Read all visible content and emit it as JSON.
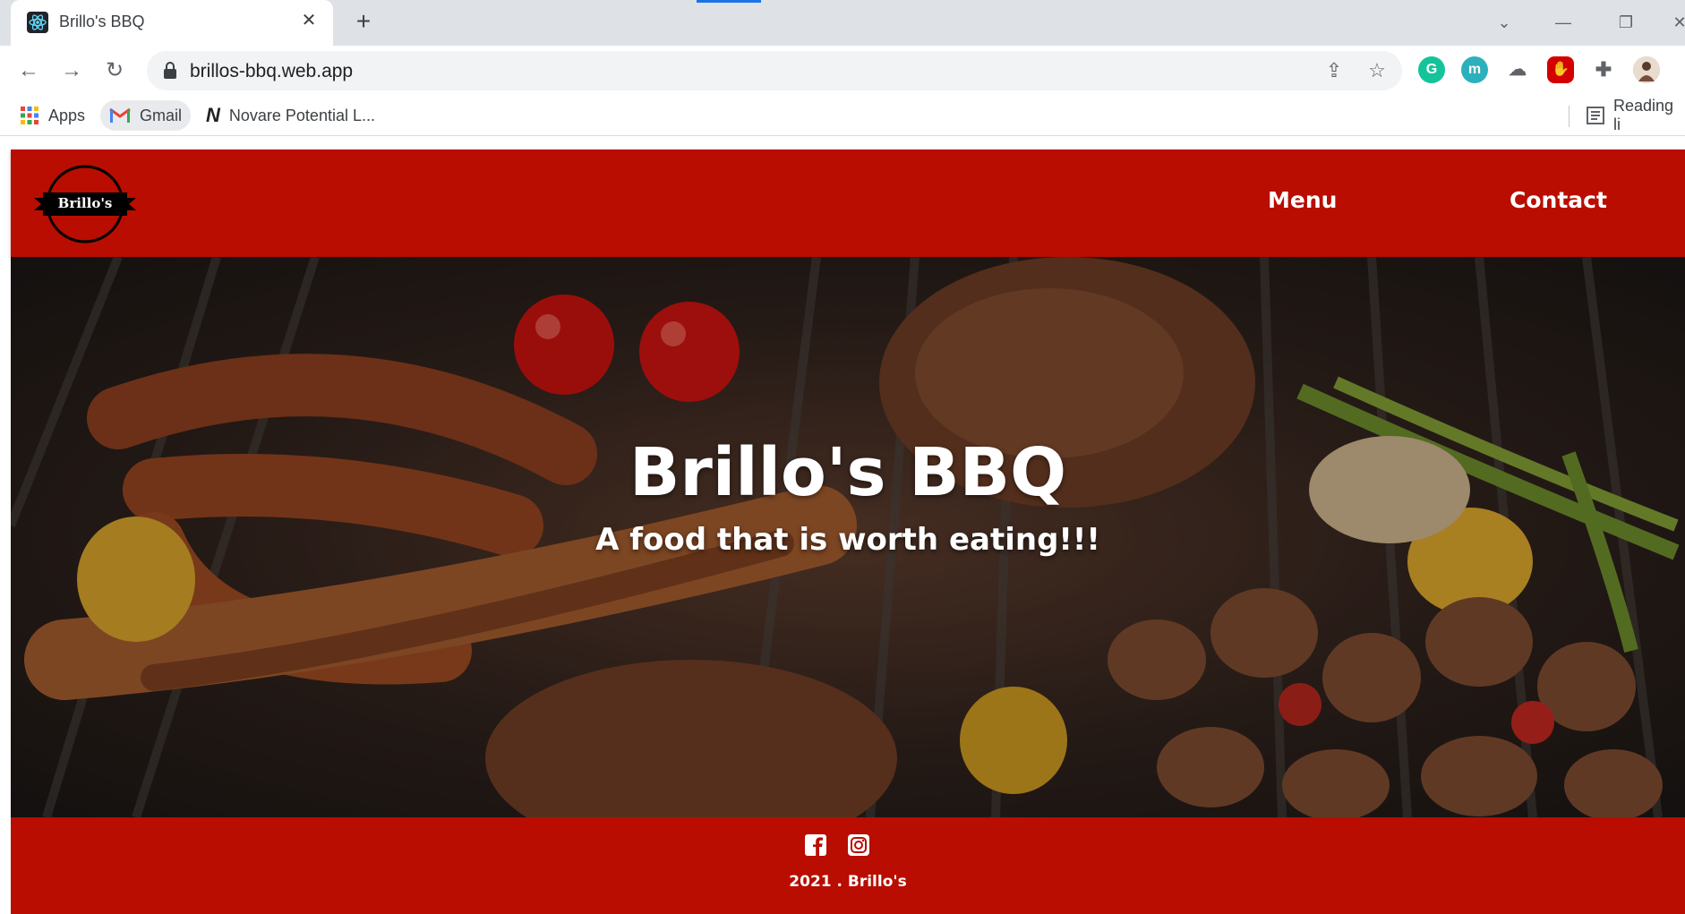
{
  "browser": {
    "tab_title": "Brillo's BBQ",
    "url": "brillos-bbq.web.app",
    "bookmarks": [
      {
        "label": "Apps"
      },
      {
        "label": "Gmail"
      },
      {
        "label": "Novare Potential L..."
      }
    ],
    "reading_list_label": "Reading li"
  },
  "site": {
    "logo_text": "Brillo's",
    "nav": [
      "Menu",
      "Contact"
    ],
    "hero_title": "Brillo's BBQ",
    "hero_subtitle": "A food that is worth eating!!!",
    "footer_text": "2021 . Brillo's"
  },
  "colors": {
    "brand_red": "#b80d00",
    "chrome_gray": "#dee1e6"
  },
  "icons": [
    "react-favicon",
    "close-icon",
    "plus-icon",
    "back-icon",
    "forward-icon",
    "reload-icon",
    "lock-icon",
    "share-icon",
    "star-icon",
    "grammarly-icon",
    "extension-m-icon",
    "cloud-icon",
    "adblock-icon",
    "puzzle-icon",
    "profile-avatar",
    "apps-grid-icon",
    "gmail-icon",
    "notion-icon",
    "reading-list-icon",
    "facebook-icon",
    "instagram-icon"
  ]
}
